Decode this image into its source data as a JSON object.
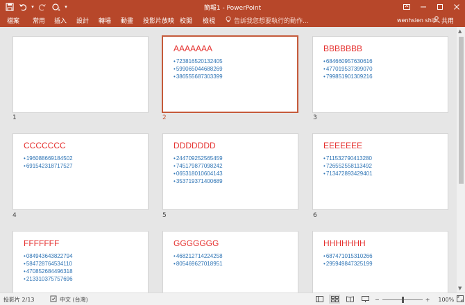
{
  "window": {
    "title": "簡報1 - PowerPoint",
    "qat_repeat_count": "5"
  },
  "ribbon": {
    "tabs": [
      {
        "label": "檔案"
      },
      {
        "label": "常用"
      },
      {
        "label": "插入"
      },
      {
        "label": "設計"
      },
      {
        "label": "轉場"
      },
      {
        "label": "動畫"
      },
      {
        "label": "投影片放映"
      },
      {
        "label": "校閱"
      },
      {
        "label": "檢視"
      }
    ],
    "tell_me": "告訴我您想要執行的動作...",
    "user": "wenhsien shih",
    "share": "共用"
  },
  "slides": [
    {
      "number": "1",
      "title": "",
      "bullets": []
    },
    {
      "number": "2",
      "title": "AAAAAAA",
      "bullets": [
        "723816520132405",
        "599065044688269",
        "386555687303399"
      ]
    },
    {
      "number": "3",
      "title": "BBBBBBB",
      "bullets": [
        "684660957630616",
        "477019537399070",
        "799851901309216"
      ]
    },
    {
      "number": "4",
      "title": "CCCCCCC",
      "bullets": [
        "196088669184502",
        "691542318717527"
      ]
    },
    {
      "number": "5",
      "title": "DDDDDDD",
      "bullets": [
        "244709252565459",
        "745179877098242",
        "065318010604143",
        "353719371400689"
      ]
    },
    {
      "number": "6",
      "title": "EEEEEEE",
      "bullets": [
        "711532790413280",
        "726552558113492",
        "713472893429401"
      ]
    },
    {
      "number": "",
      "title": "FFFFFFF",
      "bullets": [
        "084943643822794",
        "584728764534110",
        "470852684496318",
        "213310375757696"
      ]
    },
    {
      "number": "",
      "title": "GGGGGGG",
      "bullets": [
        "468212714224258",
        "805469627018951"
      ]
    },
    {
      "number": "",
      "title": "HHHHHHH",
      "bullets": [
        "687471015310266",
        "295949847325199"
      ]
    }
  ],
  "status": {
    "slide_info": "投影片 2/13",
    "language": "中文 (台灣)",
    "zoom": "100%",
    "zoom_fraction": 0.5
  },
  "colors": {
    "ribbon": "#b7472a",
    "slide_title": "#e5312f",
    "bullet_text": "#2e74b5",
    "selection": "#c55a3a"
  }
}
